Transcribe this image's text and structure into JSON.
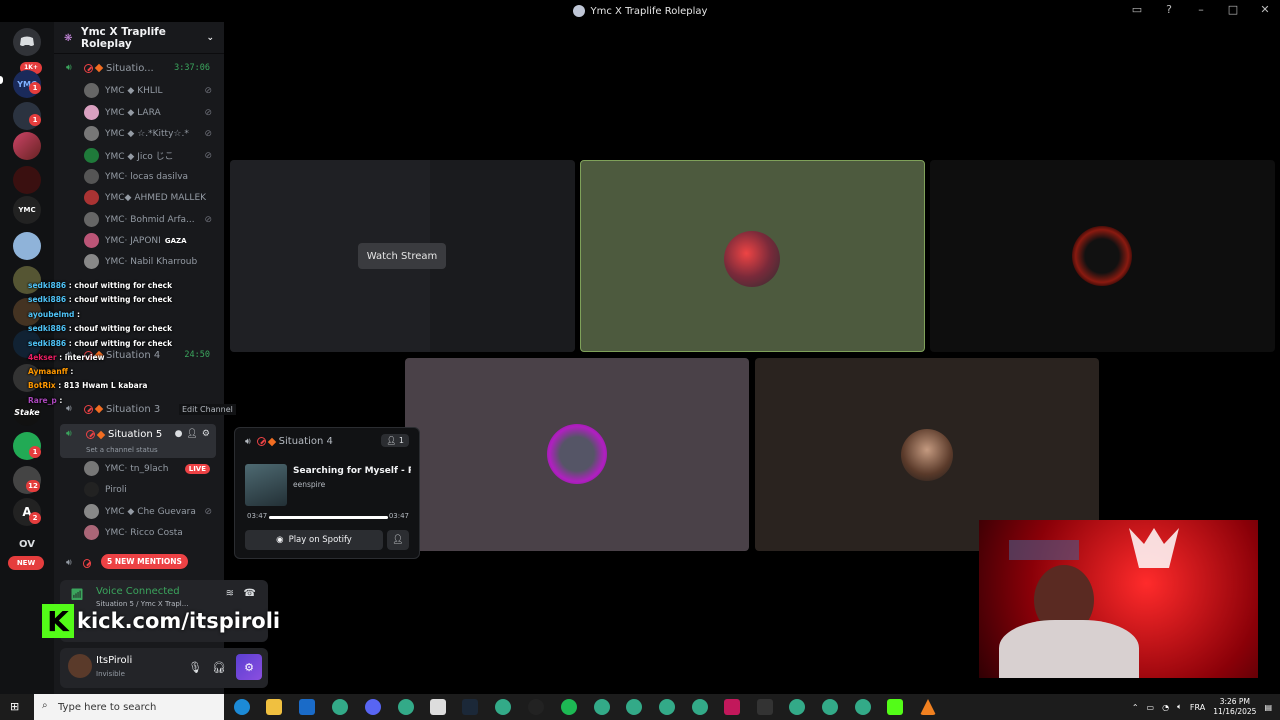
{
  "window": {
    "title": "Ymc X Traplife Roleplay"
  },
  "guilds": {
    "home_badge": "1K+",
    "items": [
      {
        "name": "YMC",
        "badge": "1"
      },
      {
        "name": "",
        "badge": "1"
      },
      {
        "name": "YMC",
        "badge": ""
      },
      {
        "name": "Stake",
        "badge": ""
      },
      {
        "name": "",
        "badge": "1"
      },
      {
        "name": "",
        "badge": "12"
      },
      {
        "name": "A",
        "badge": "2"
      },
      {
        "name": "OV",
        "badge": ""
      }
    ],
    "new_label": "NEW"
  },
  "sidebar": {
    "server_name": "Ymc X Traplife Roleplay",
    "channels": [
      {
        "name": "Situatio...",
        "timer": "3:37:06"
      },
      {
        "name": "Situation 4",
        "timer": "24:50"
      },
      {
        "name": "Situation 3",
        "timer": ""
      },
      {
        "name": "Situation 5",
        "timer": ""
      }
    ],
    "users_top": [
      "YMC ◆ KHLIL",
      "YMC ◆ LARA",
      "YMC ◆ ☆.*Kitty☆.*",
      "YMC ◆ Jico じこ",
      "YMC⋅ locas dasilva",
      "YMC◆ AHMED MALLEK",
      "YMC⋅ Bohmid Arfa...",
      "YMC⋅ JAPONI",
      "YMC⋅ Nabil Kharroub"
    ],
    "japoni_tag": "GAZA",
    "users_s5": [
      "YMC⋅ tn_9lach",
      "Piroli",
      "YMC ◆ Che Guevara",
      "YMC⋅ Ricco Costa"
    ],
    "live_label": "LIVE",
    "edit_channel_tooltip": "Edit Channel",
    "channel_status_placeholder": "Set a channel status",
    "mentions": "5 NEW MENTIONS"
  },
  "voice": {
    "status": "Voice Connected",
    "channel": "Situation 5 / Ymc X Trapl..."
  },
  "user": {
    "name": "ItsPiroli",
    "status": "Invisible"
  },
  "stage": {
    "watch_stream": "Watch Stream"
  },
  "popup": {
    "channel": "Situation 4",
    "count": "1",
    "song": "Searching for Myself - Rei...",
    "artist": "eenspire",
    "elapsed": "03:47",
    "duration": "03:47",
    "progress": 1,
    "spotify_button": "Play on Spotify"
  },
  "chat_overlay": [
    {
      "user": "sedki886",
      "msg": ": chouf witting for check"
    },
    {
      "user": "sedki886",
      "msg": ": chouf witting for check"
    },
    {
      "user": "ayoubelmd",
      "msg": ":"
    },
    {
      "user": "sedki886",
      "msg": ": chouf witting for check"
    },
    {
      "user": "sedki886",
      "msg": ": chouf witting for check"
    },
    {
      "user": "4ekser",
      "msg": ": interview"
    },
    {
      "user": "Aymaanff",
      "msg": ":"
    },
    {
      "user": "BotRix",
      "msg": ": 813 Hwam L kabara"
    },
    {
      "user": "Rare_p",
      "msg": ":"
    }
  ],
  "kick_url": "kick.com/itspiroli",
  "taskbar": {
    "search_placeholder": "Type here to search",
    "lang": "FRA",
    "time": "3:26 PM",
    "date": "11/16/2025"
  }
}
